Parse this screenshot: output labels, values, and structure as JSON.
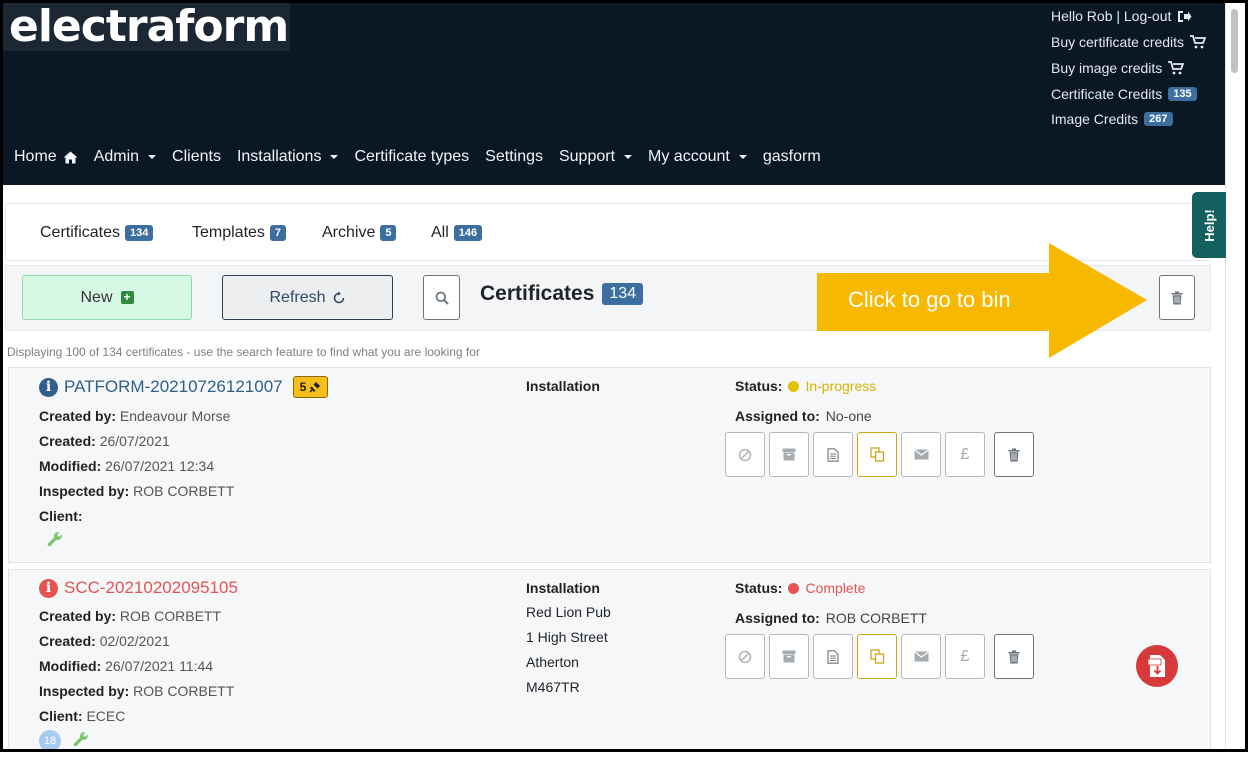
{
  "header": {
    "logo": "electraform",
    "user": {
      "greeting": "Hello Rob | Log-out",
      "buy_certificate_credits": "Buy certificate credits",
      "buy_image_credits": "Buy image credits",
      "certificate_credits_label": "Certificate Credits",
      "certificate_credits_count": "135",
      "image_credits_label": "Image Credits",
      "image_credits_count": "267"
    },
    "nav": [
      {
        "label": "Home",
        "has_caret": false,
        "icon": "home-icon"
      },
      {
        "label": "Admin",
        "has_caret": true
      },
      {
        "label": "Clients",
        "has_caret": false
      },
      {
        "label": "Installations",
        "has_caret": true
      },
      {
        "label": "Certificate types",
        "has_caret": false
      },
      {
        "label": "Settings",
        "has_caret": false
      },
      {
        "label": "Support",
        "has_caret": true
      },
      {
        "label": "My account",
        "has_caret": true
      },
      {
        "label": "gasform",
        "has_caret": false
      }
    ]
  },
  "tabs": [
    {
      "label": "Certificates",
      "count": "134"
    },
    {
      "label": "Templates",
      "count": "7"
    },
    {
      "label": "Archive",
      "count": "5"
    },
    {
      "label": "All",
      "count": "146"
    }
  ],
  "toolbar": {
    "new_label": "New",
    "refresh_label": "Refresh",
    "title": "Certificates",
    "title_count": "134"
  },
  "callout": {
    "text": "Click to go to bin",
    "color": "#f6b800"
  },
  "help_label": "Help!",
  "display_message": "Displaying 100 of 134 certificates - use the search feature to find what you are looking for",
  "labels": {
    "created_by": "Created by:",
    "created": "Created:",
    "modified": "Modified:",
    "inspected_by": "Inspected by:",
    "client": "Client:",
    "installation": "Installation",
    "status": "Status:",
    "assigned_to": "Assigned to:"
  },
  "certificates": [
    {
      "id": "PATFORM-20210726121007",
      "title_color": "#2f5f8a",
      "chip": "5",
      "created_by": "Endeavour Morse",
      "created": "26/07/2021",
      "modified": "26/07/2021 12:34",
      "inspected_by": "ROB CORBETT",
      "client": "",
      "installation_lines": [],
      "status": "In-progress",
      "status_color": "#e3c100",
      "assigned_to": "No-one"
    },
    {
      "id": "SCC-20210202095105",
      "title_color": "#e55353",
      "created_by": "ROB CORBETT",
      "created": "02/02/2021",
      "modified": "26/07/2021 11:44",
      "inspected_by": "ROB CORBETT",
      "client": "ECEC",
      "client_count": "18",
      "installation_lines": [
        "Red Lion Pub",
        "1 High Street",
        "Atherton",
        "M467TR"
      ],
      "status": "Complete",
      "status_color": "#e55353",
      "assigned_to": "ROB CORBETT"
    }
  ],
  "colors": {
    "header_bg": "#0a1724",
    "badge": "#3d6ea0",
    "help_tab": "#14605f"
  }
}
